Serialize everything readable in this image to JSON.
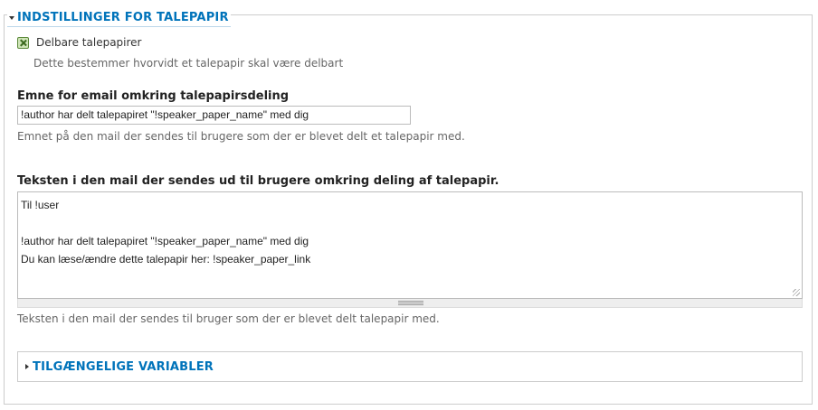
{
  "fieldset": {
    "legend": "INDSTILLINGER FOR TALEPAPIR",
    "checkbox": {
      "label": "Delbare talepapirer",
      "description": "Dette bestemmer hvorvidt et talepapir skal være delbart"
    },
    "subject": {
      "label": "Emne for email omkring talepapirsdeling",
      "value": "!author har delt talepapiret \"!speaker_paper_name\" med dig",
      "description": "Emnet på den mail der sendes til brugere som der er blevet delt et talepapir med."
    },
    "body": {
      "label": "Teksten i den mail der sendes ud til brugere omkring deling af talepapir.",
      "value": "Til !user\n\n!author har delt talepapiret \"!speaker_paper_name\" med dig\nDu kan læse/ændre dette talepapir her: !speaker_paper_link",
      "description": "Teksten i den mail der sendes til bruger som der er blevet delt talepapir med."
    },
    "variables": {
      "legend": "TILGÆNGELIGE VARIABLER"
    }
  }
}
